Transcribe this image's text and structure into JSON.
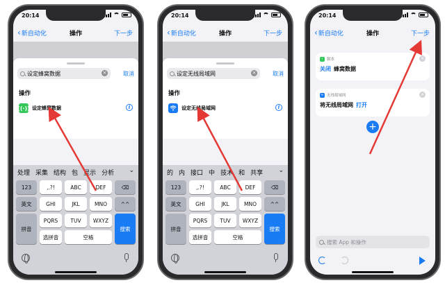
{
  "status_time": "20:14",
  "nav": {
    "back_label": "新自动化",
    "title": "操作",
    "next_label": "下一步"
  },
  "phone1": {
    "search_query": "设定蜂窝数据",
    "cancel_label": "取消",
    "section_title": "操作",
    "action_label": "设定蜂窝数据",
    "action_icon": "cellular-icon",
    "action_color": "#34c759",
    "candidates": [
      "处理",
      "采集",
      "结构",
      "包",
      "显示",
      "分析"
    ]
  },
  "phone2": {
    "search_query": "设定无线局域网",
    "cancel_label": "取消",
    "section_title": "操作",
    "action_label": "设定无线局域网",
    "action_icon": "wifi-icon",
    "action_color": "#1a7cf4",
    "candidates": [
      "的",
      "内",
      "接口",
      "中",
      "技术",
      "和",
      "共享"
    ]
  },
  "keyboard": {
    "row1": [
      "123",
      ",.?!",
      "ABC",
      "DEF"
    ],
    "row2": [
      "英文",
      "GHI",
      "JKL",
      "MNO",
      "^^"
    ],
    "row3": [
      "拼音",
      "PQRS",
      "TUV",
      "WXYZ"
    ],
    "row4": [
      "选拼音",
      "空格"
    ],
    "search_key": "搜索"
  },
  "phone3": {
    "card1": {
      "category": "脚本",
      "token": "关闭",
      "text": "蜂窝数据"
    },
    "card2": {
      "category": "无线局域网",
      "text": "将无线局域网",
      "token": "打开"
    },
    "bottom_search_placeholder": "搜索 App 和操作"
  },
  "colors": {
    "accent": "#1a7cf4",
    "arrow": "#e53935",
    "green": "#34c759"
  }
}
